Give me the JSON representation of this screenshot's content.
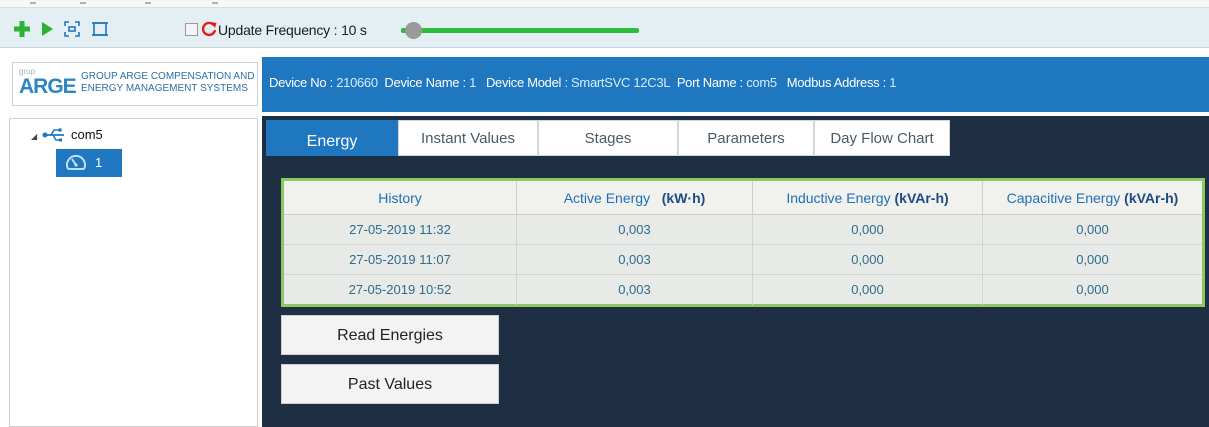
{
  "toolbar": {
    "icons": [
      "add-icon",
      "play-icon",
      "fit-view-icon",
      "fullscreen-icon",
      "refresh-icon"
    ],
    "update_frequency_label": "Update Frequency :",
    "update_frequency_value": "10 s",
    "slider_level": 0.05
  },
  "logo": {
    "small_text": "grup",
    "main_text": "ARGE",
    "line1": "GROUP ARGE COMPENSATION AND",
    "line2": "ENERGY MANAGEMENT SYSTEMS"
  },
  "device_header": {
    "device_no_label": "Device No :",
    "device_no_value": "210660",
    "device_name_label": "Device Name :",
    "device_name_value": "1",
    "device_model_label": "Device Model",
    "device_model_value": ": SmartSVC 12C3L",
    "port_name_label": "Port Name :",
    "port_name_value": "com5",
    "modbus_label": "Modbus Address :",
    "modbus_value": "1"
  },
  "tree": {
    "port": "com5",
    "device": "1"
  },
  "tabs": [
    {
      "label": "Energy"
    },
    {
      "label": "Instant Values"
    },
    {
      "label": "Stages"
    },
    {
      "label": "Parameters"
    },
    {
      "label": "Day Flow Chart"
    }
  ],
  "table": {
    "headers": {
      "history": "History",
      "active": "Active Energy",
      "active_unit": "(kW·h)",
      "inductive": "Inductive Energy",
      "inductive_unit": "(kVAr-h)",
      "capacitive": "Capacitive Energy",
      "capacitive_unit": "(kVAr-h)"
    },
    "rows": [
      {
        "history": "27-05-2019 11:32",
        "active": "0,003",
        "inductive": "0,000",
        "capacitive": "0,000"
      },
      {
        "history": "27-05-2019 11:07",
        "active": "0,003",
        "inductive": "0,000",
        "capacitive": "0,000"
      },
      {
        "history": "27-05-2019 10:52",
        "active": "0,003",
        "inductive": "0,000",
        "capacitive": "0,000"
      }
    ]
  },
  "buttons": {
    "read_energies": "Read Energies",
    "past_values": "Past Values"
  },
  "colors": {
    "header_blue": "#1f77c0",
    "main_dark": "#1f2f43",
    "grid_border": "#8cc861",
    "slider_green": "#2dbd3c",
    "add_green": "#2bb233"
  }
}
